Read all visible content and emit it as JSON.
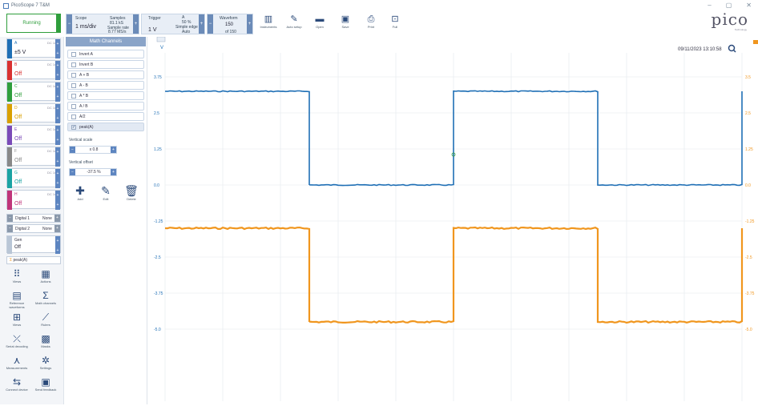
{
  "window": {
    "title": "PicoScope 7 T&M",
    "controls": [
      "–",
      "▢",
      "✕"
    ]
  },
  "toolbar": {
    "run_label": "Running",
    "scope_label": "Scope",
    "timebase": "1 ms/div",
    "samples_label": "Samples",
    "samples_val": "81.1 kS",
    "sample_rate_label": "Sample rate",
    "sample_rate_val": "8.77 MS/s",
    "trigger_label": "Trigger",
    "trigger_level": "1 V",
    "trigger_pct": "50 %",
    "trigger_type": "Simple edge",
    "trigger_mode": "Auto",
    "trigger_src": "A",
    "waveform_label": "Waveform",
    "waveform_val": "150",
    "waveform_of": "of 150",
    "tools": [
      {
        "icon": "instruments-icon",
        "label": "Instruments"
      },
      {
        "icon": "auto-setup-icon",
        "label": "Auto setup"
      },
      {
        "icon": "open-icon",
        "label": "Open"
      },
      {
        "icon": "save-icon",
        "label": "Save"
      },
      {
        "icon": "print-icon",
        "label": "Print"
      },
      {
        "icon": "full-screen-icon",
        "label": "Full"
      }
    ],
    "logo": "pico",
    "logo_sub": "Technology"
  },
  "channels": [
    {
      "name": "A",
      "coupling": "DC 1x",
      "range": "±5 V",
      "color": "#1f6fb5"
    },
    {
      "name": "B",
      "coupling": "DC 1x",
      "range": "Off",
      "color": "#d93030"
    },
    {
      "name": "C",
      "coupling": "DC 1x",
      "range": "Off",
      "color": "#2f9e3c"
    },
    {
      "name": "D",
      "coupling": "DC 1x",
      "range": "Off",
      "color": "#d9a000"
    },
    {
      "name": "E",
      "coupling": "DC 1x",
      "range": "Off",
      "color": "#7a4ab8"
    },
    {
      "name": "F",
      "coupling": "DC 1x",
      "range": "Off",
      "color": "#888888"
    },
    {
      "name": "G",
      "coupling": "DC 1x",
      "range": "Off",
      "color": "#1aa3a3"
    },
    {
      "name": "H",
      "coupling": "DC 1x",
      "range": "Off",
      "color": "#c0357a"
    }
  ],
  "digital": [
    {
      "name": "Digital 1",
      "value": "None"
    },
    {
      "name": "Digital 2",
      "value": "None"
    }
  ],
  "generator": {
    "name": "Gen",
    "value": "Off"
  },
  "math_channel_badge": "peak(A)",
  "left_tools": [
    {
      "icon": "views-icon",
      "label": "Views"
    },
    {
      "icon": "actions-icon",
      "label": "Actions"
    },
    {
      "icon": "reference-waveforms-icon",
      "label": "Reference waveforms"
    },
    {
      "icon": "math-channels-icon",
      "label": "Math channels"
    },
    {
      "icon": "views-grid-icon",
      "label": "Views"
    },
    {
      "icon": "rulers-icon",
      "label": "Rulers"
    },
    {
      "icon": "serial-decoding-icon",
      "label": "Serial decoding"
    },
    {
      "icon": "masks-icon",
      "label": "Masks"
    },
    {
      "icon": "measurements-icon",
      "label": "Measurements"
    },
    {
      "icon": "settings-icon",
      "label": "Settings"
    },
    {
      "icon": "connect-device-icon",
      "label": "Connect device"
    },
    {
      "icon": "send-feedback-icon",
      "label": "Send feedback"
    }
  ],
  "math_panel": {
    "header": "Math Channels",
    "items": [
      {
        "label": "Invert A",
        "checked": false
      },
      {
        "label": "Invert B",
        "checked": false
      },
      {
        "label": "A + B",
        "checked": false
      },
      {
        "label": "A - B",
        "checked": false
      },
      {
        "label": "A * B",
        "checked": false
      },
      {
        "label": "A / B",
        "checked": false
      },
      {
        "label": "A/2",
        "checked": false
      },
      {
        "label": "peak(A)",
        "checked": true
      }
    ],
    "vertical_scale_label": "Vertical scale",
    "vertical_scale_val": "x 0.8",
    "vertical_offset_label": "Vertical offset",
    "vertical_offset_val": "-37.5 %",
    "actions": [
      {
        "icon": "add-icon",
        "label": "Add"
      },
      {
        "icon": "edit-icon",
        "label": "Edit"
      },
      {
        "icon": "delete-icon",
        "label": "Delete"
      }
    ]
  },
  "scope_view": {
    "timestamp": "09/11/2023 13:10:58",
    "left_axis_unit": "V",
    "left_ticks": [
      "3.75",
      "2.5",
      "1.25",
      "0.0",
      "-1.25",
      "-2.5",
      "-3.75",
      "-5.0"
    ],
    "right_ticks": [
      "3.5",
      "2.5",
      "1.25",
      "0.0",
      "-1.25",
      "-2.5",
      "-3.75",
      "-5.0"
    ],
    "trace_a_color": "#1f6fb5",
    "trace_math_color": "#f0961e",
    "trace_a_high": 3.25,
    "trace_a_low": 0.0,
    "trace_math_high": -1.5,
    "trace_math_low": -4.75,
    "edges_divisions": [
      0,
      2.5,
      5,
      7.5,
      10
    ]
  }
}
